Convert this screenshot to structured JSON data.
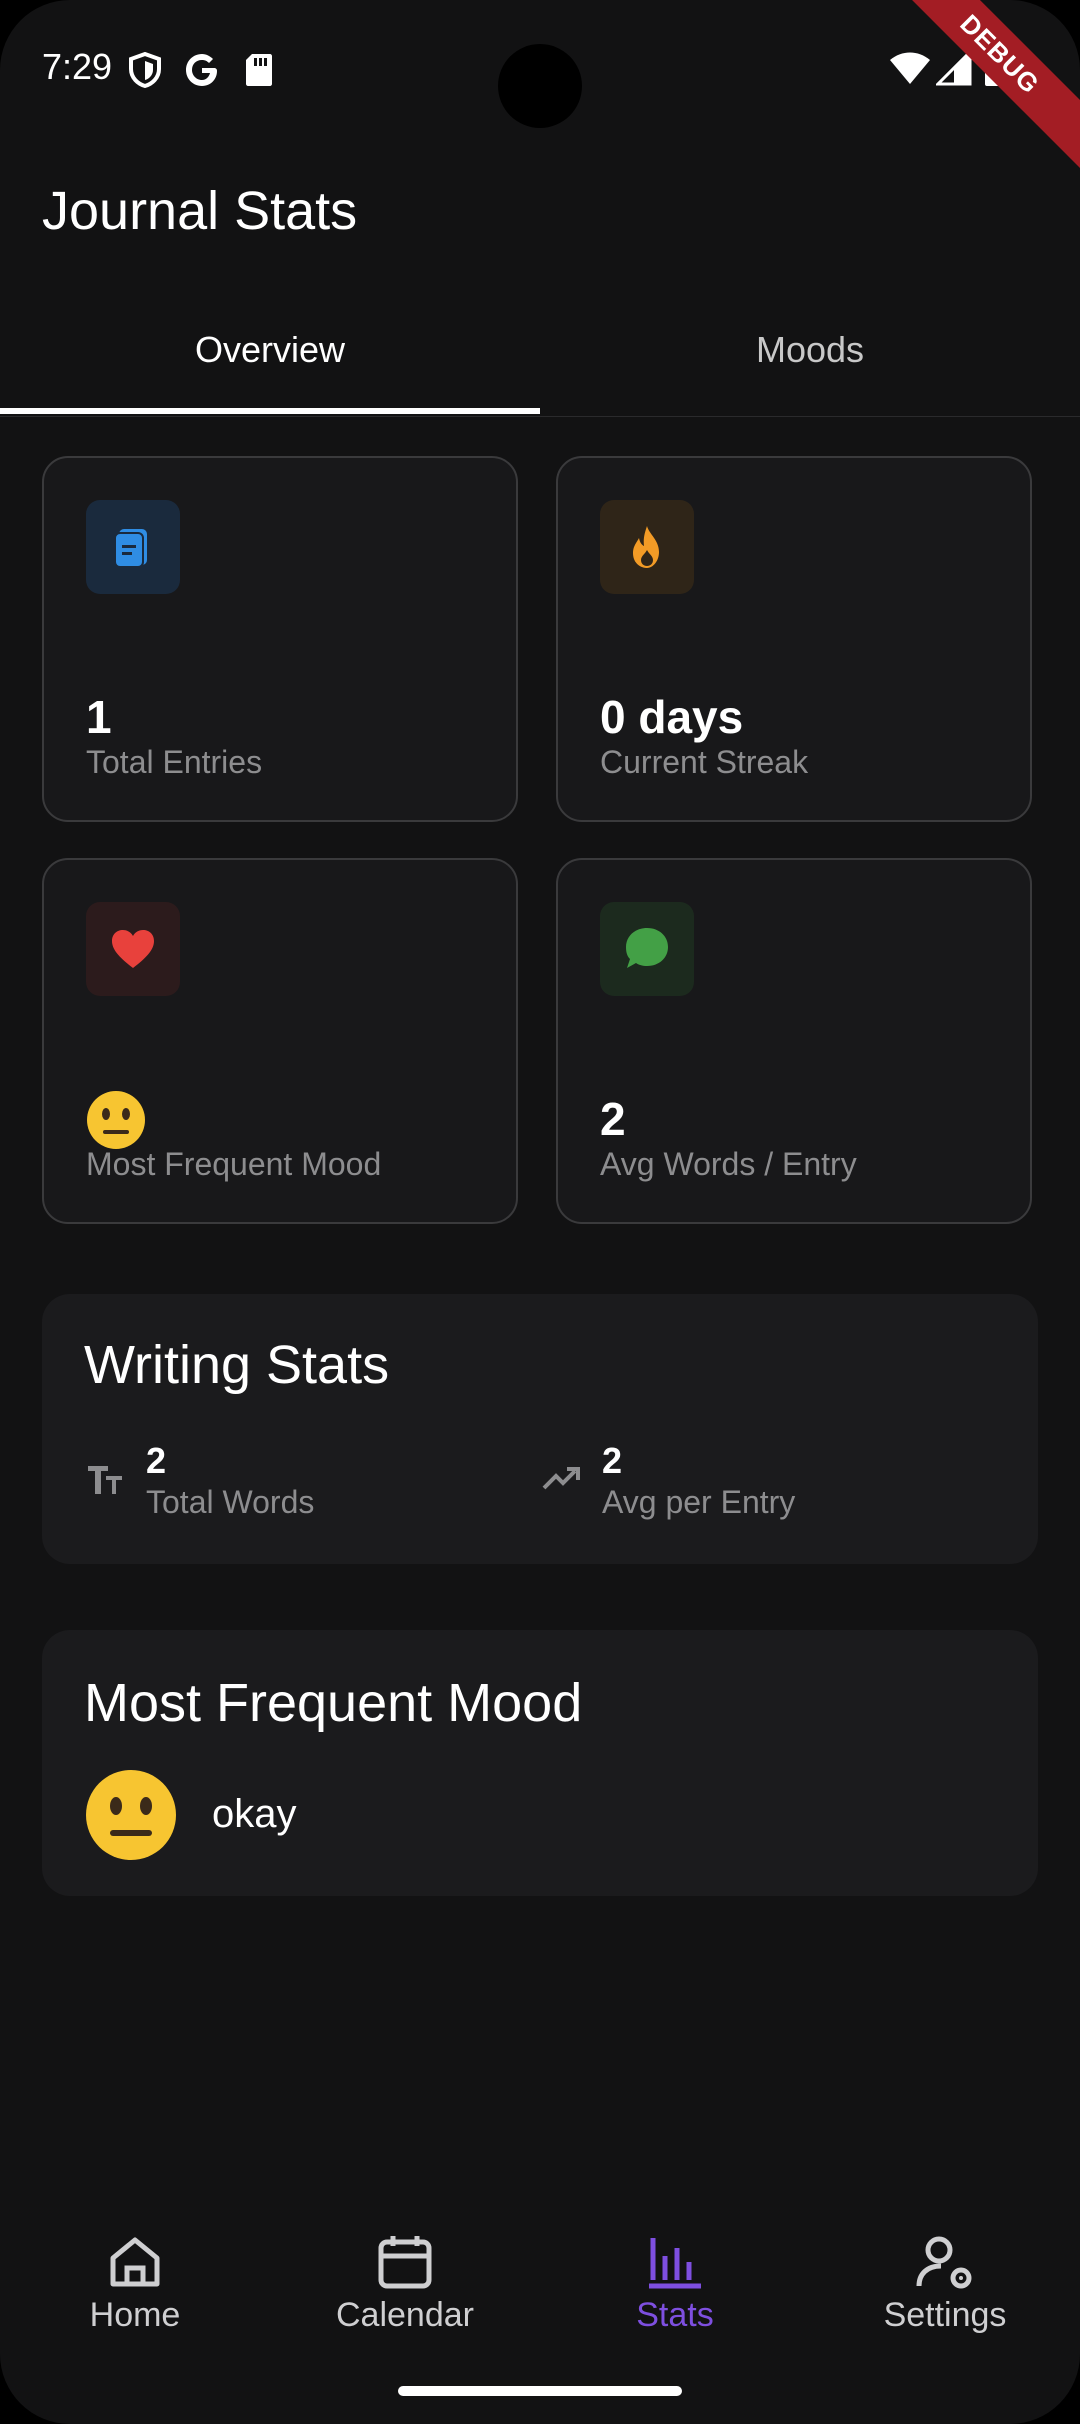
{
  "status_bar": {
    "time": "7:29",
    "debug_label": "DEBUG"
  },
  "header": {
    "title": "Journal Stats"
  },
  "tabs": [
    {
      "label": "Overview",
      "active": true
    },
    {
      "label": "Moods",
      "active": false
    }
  ],
  "stat_cards": {
    "total_entries": {
      "value": "1",
      "label": "Total Entries",
      "icon": "note-icon",
      "color": "#2f8de4"
    },
    "current_streak": {
      "value": "0 days",
      "label": "Current Streak",
      "icon": "fire-icon",
      "color": "#f29b26"
    },
    "most_frequent_mood": {
      "value": "neutral-face-emoji",
      "label": "Most Frequent Mood",
      "icon": "heart-icon",
      "color": "#e8413c"
    },
    "avg_words": {
      "value": "2",
      "label": "Avg Words / Entry",
      "icon": "chat-bubble-icon",
      "color": "#43a046"
    }
  },
  "writing_stats": {
    "title": "Writing Stats",
    "total_words": {
      "value": "2",
      "label": "Total Words",
      "icon": "text-size-icon"
    },
    "avg_per_entry": {
      "value": "2",
      "label": "Avg per Entry",
      "icon": "trending-up-icon"
    }
  },
  "mood_panel": {
    "title": "Most Frequent Mood",
    "mood": "okay",
    "emoji": "neutral-face-emoji"
  },
  "bottom_nav": [
    {
      "label": "Home",
      "icon": "home-icon",
      "active": false
    },
    {
      "label": "Calendar",
      "icon": "calendar-icon",
      "active": false
    },
    {
      "label": "Stats",
      "icon": "bar-chart-icon",
      "active": true
    },
    {
      "label": "Settings",
      "icon": "settings-person-icon",
      "active": false
    }
  ],
  "colors": {
    "background": "#121213",
    "accent": "#7e4fe0",
    "card_border": "#3a3a3c",
    "muted_text": "#8d8d8f"
  }
}
